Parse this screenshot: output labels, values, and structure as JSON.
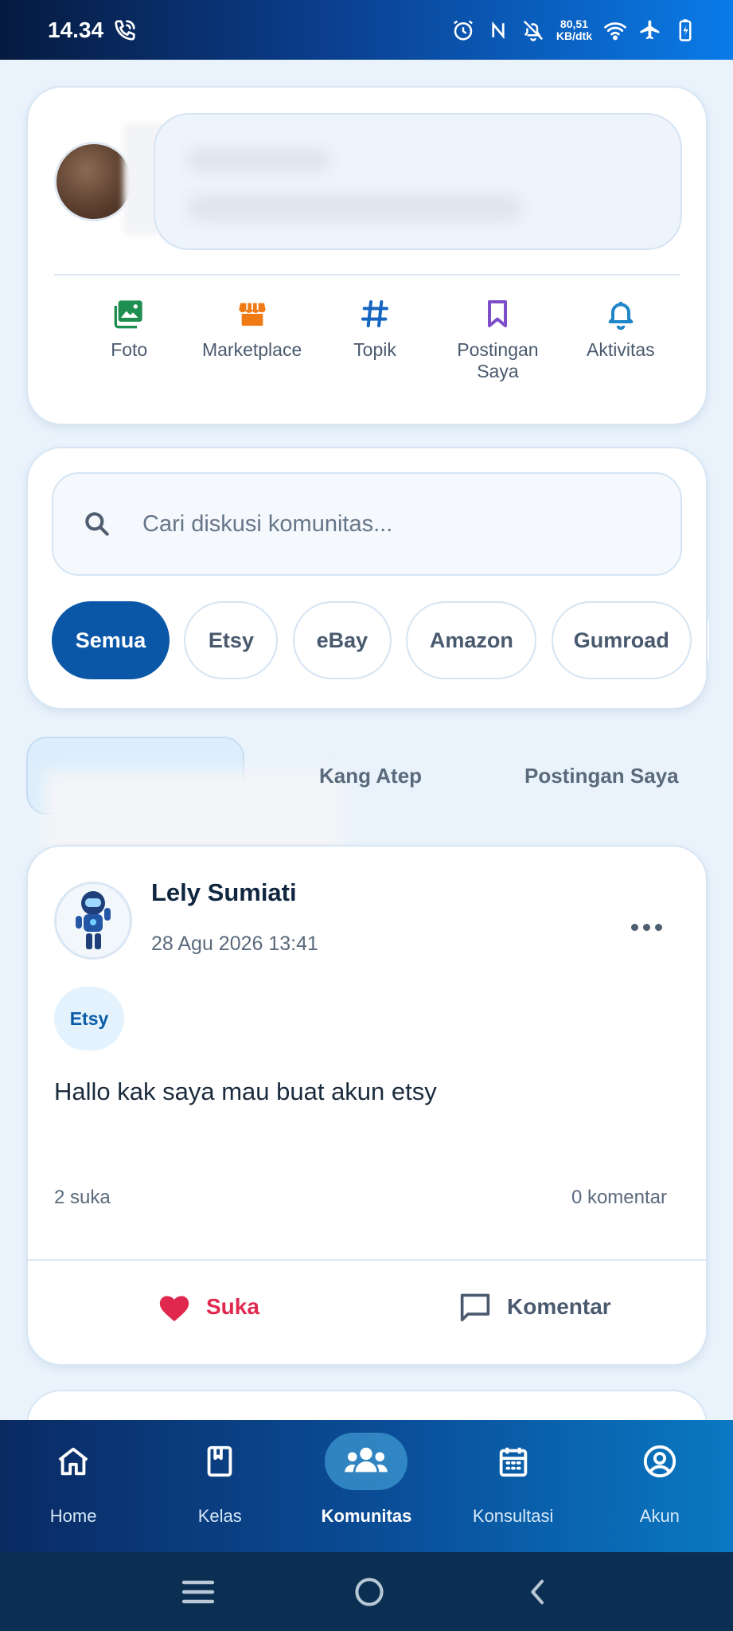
{
  "status_bar": {
    "time": "14.34",
    "net_speed_value": "80,51",
    "net_speed_unit": "KB/dtk",
    "icons": [
      "phone-call-icon",
      "alarm-icon",
      "nfc-icon",
      "bell-off-icon",
      "wifi-icon",
      "airplane-icon",
      "battery-charging-icon"
    ]
  },
  "composer": {
    "quick_actions": [
      {
        "label": "Foto",
        "icon": "image-icon",
        "color": "#1e8f4e"
      },
      {
        "label": "Marketplace",
        "icon": "store-icon",
        "color": "#f07a14"
      },
      {
        "label": "Topik",
        "icon": "hashtag-icon",
        "color": "#1565c0"
      },
      {
        "label": "Postingan Saya",
        "icon": "bookmark-icon",
        "color": "#7e4fc9"
      },
      {
        "label": "Aktivitas",
        "icon": "bell-icon",
        "color": "#1f86c8"
      }
    ]
  },
  "search": {
    "placeholder": "Cari diskusi komunitas...",
    "chips": [
      "Semua",
      "Etsy",
      "eBay",
      "Amazon",
      "Gumroad"
    ],
    "active_chip": "Semua"
  },
  "tabs": {
    "items": [
      "Kang Atep",
      "Postingan Saya"
    ]
  },
  "post": {
    "author": "Lely Sumiati",
    "date": "28 Agu 2026 13:41",
    "tag": "Etsy",
    "text": "Hallo kak saya mau buat akun etsy",
    "likes": "2 suka",
    "comments": "0 komentar",
    "like_label": "Suka",
    "comment_label": "Komentar"
  },
  "bottom_nav": {
    "items": [
      {
        "label": "Home",
        "icon": "home-icon"
      },
      {
        "label": "Kelas",
        "icon": "book-icon"
      },
      {
        "label": "Komunitas",
        "icon": "users-icon"
      },
      {
        "label": "Konsultasi",
        "icon": "calendar-icon"
      },
      {
        "label": "Akun",
        "icon": "user-circle-icon"
      }
    ],
    "active": "Komunitas"
  },
  "colors": {
    "primary": "#0a57a8",
    "like": "#e0284f",
    "background": "#eaf3fc"
  }
}
